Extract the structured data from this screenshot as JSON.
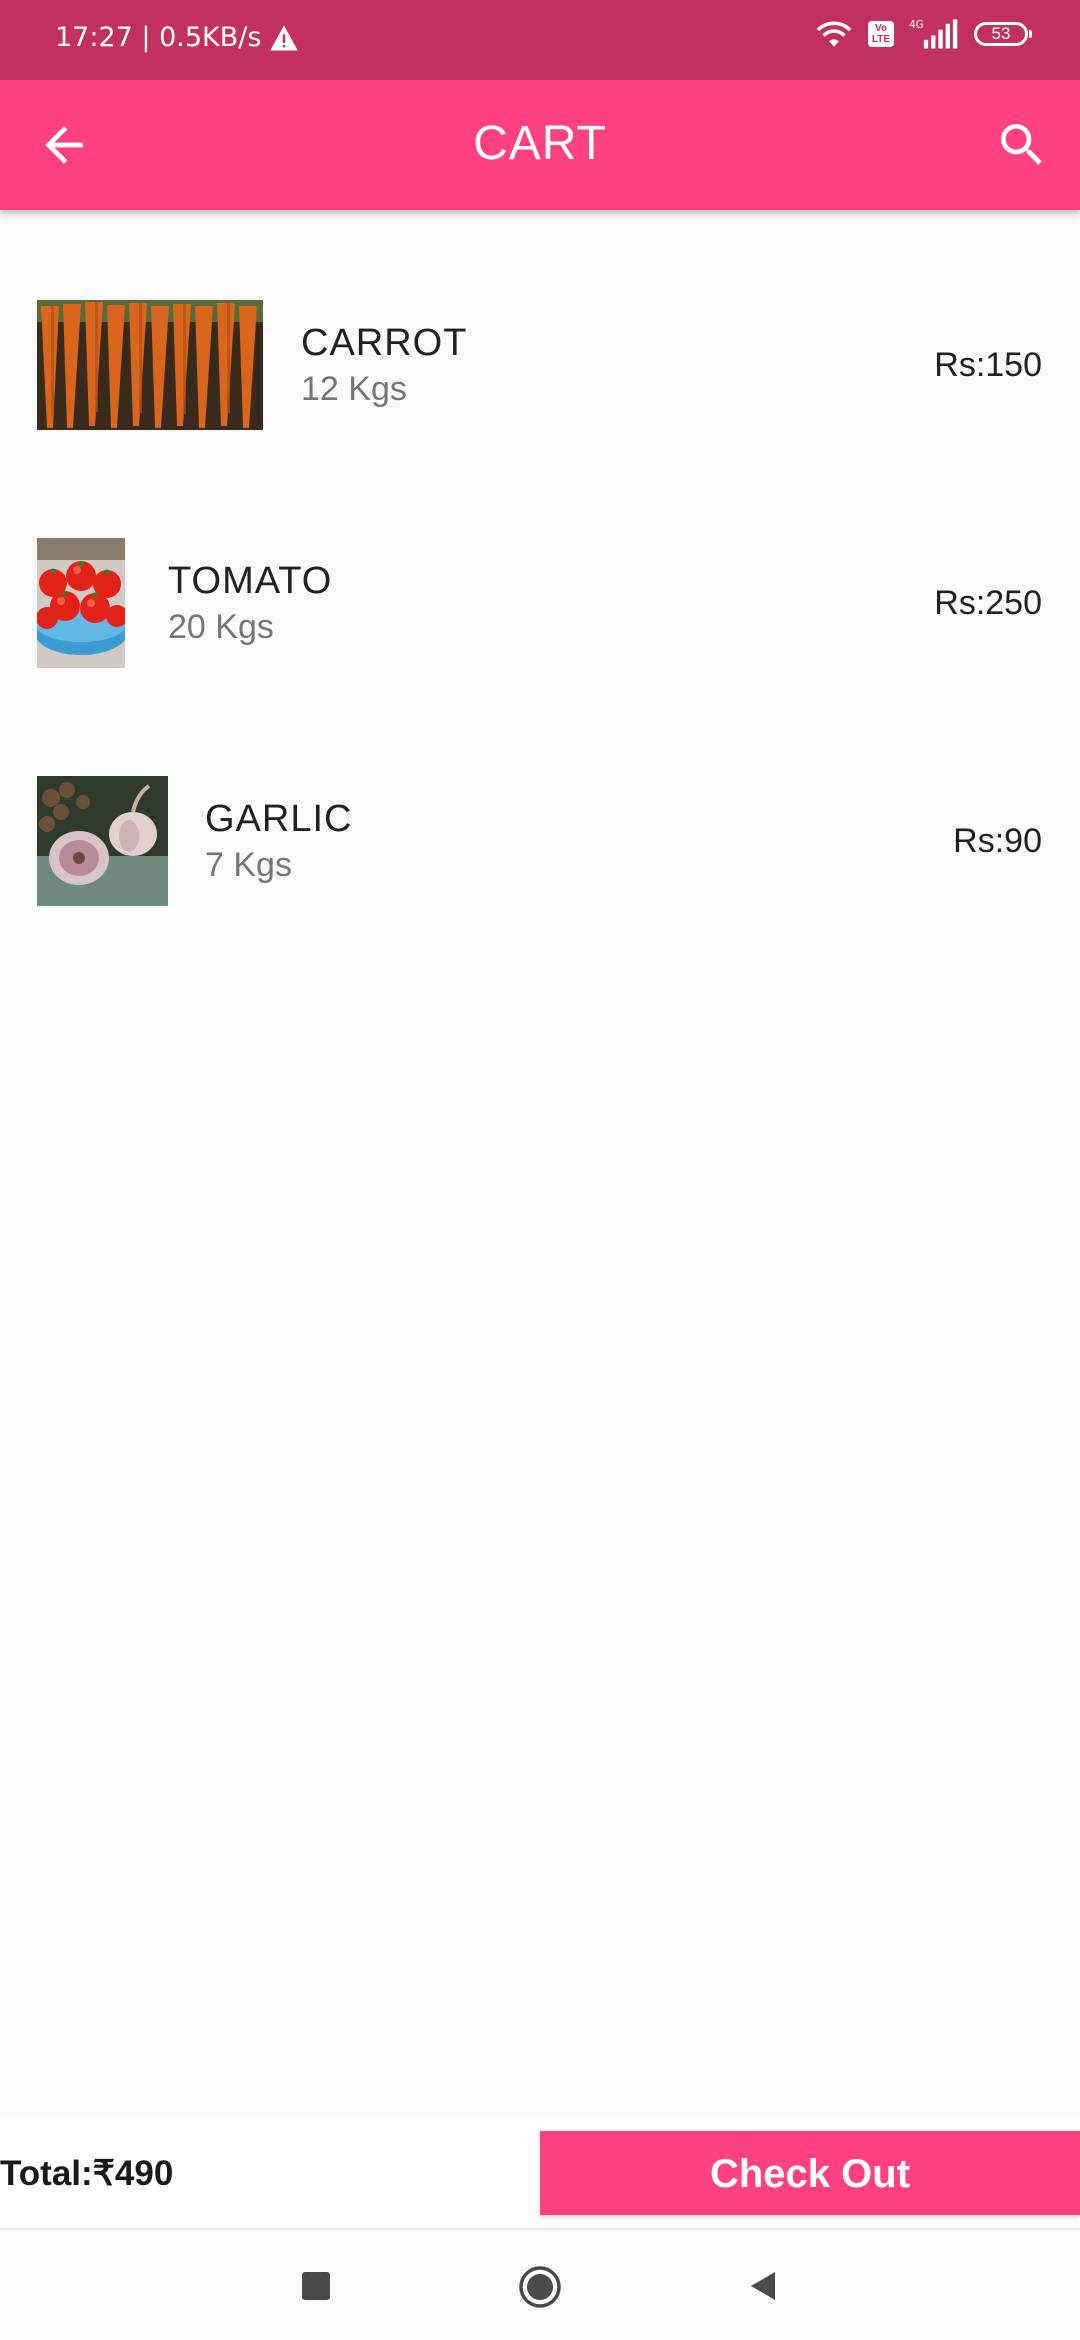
{
  "status_bar": {
    "time_speed": "17:27 | 0.5KB/s",
    "volte": "Vo\nLTE",
    "network": "4G",
    "battery": "53"
  },
  "app_bar": {
    "title": "CART",
    "back_icon": "arrow-back-icon",
    "search_icon": "search-icon"
  },
  "cart": {
    "items": [
      {
        "name": "CARROT",
        "quantity": "12 Kgs",
        "price": "Rs:150",
        "image": "carrot-image"
      },
      {
        "name": "TOMATO",
        "quantity": "20 Kgs",
        "price": "Rs:250",
        "image": "tomato-image"
      },
      {
        "name": "GARLIC",
        "quantity": "7 Kgs",
        "price": "Rs:90",
        "image": "garlic-image"
      }
    ]
  },
  "footer": {
    "total": "Total:₹490",
    "checkout_label": "Check Out"
  },
  "colors": {
    "status_bar": "#c2305f",
    "primary": "#ff4081",
    "background": "#fafafa"
  }
}
